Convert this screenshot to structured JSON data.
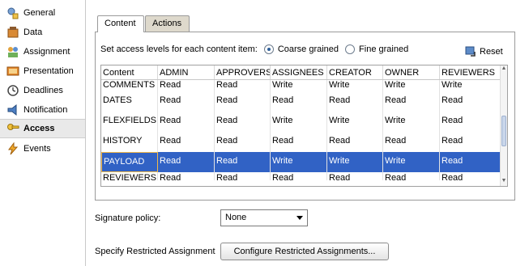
{
  "nav": {
    "items": [
      {
        "label": "General",
        "icon": "general-icon"
      },
      {
        "label": "Data",
        "icon": "data-icon"
      },
      {
        "label": "Assignment",
        "icon": "assignment-icon"
      },
      {
        "label": "Presentation",
        "icon": "presentation-icon"
      },
      {
        "label": "Deadlines",
        "icon": "deadlines-icon"
      },
      {
        "label": "Notification",
        "icon": "notification-icon"
      },
      {
        "label": "Access",
        "icon": "access-icon",
        "selected": true
      },
      {
        "label": "Events",
        "icon": "events-icon"
      }
    ]
  },
  "tabs": [
    {
      "label": "Content",
      "active": true
    },
    {
      "label": "Actions",
      "active": false
    }
  ],
  "access": {
    "prompt": "Set access levels for each content item:",
    "options": [
      "Coarse grained",
      "Fine grained"
    ],
    "selected": "Coarse grained",
    "reset_label": "Reset"
  },
  "table": {
    "columns": [
      "Content",
      "ADMIN",
      "APPROVERS",
      "ASSIGNEES",
      "CREATOR",
      "OWNER",
      "REVIEWERS"
    ],
    "rows": [
      [
        "COMMENTS",
        "Read",
        "Read",
        "Write",
        "Write",
        "Write",
        "Write"
      ],
      [
        "DATES",
        "Read",
        "Read",
        "Read",
        "Read",
        "Read",
        "Read"
      ],
      [
        "FLEXFIELDS",
        "Read",
        "Read",
        "Write",
        "Write",
        "Write",
        "Read"
      ],
      [
        "HISTORY",
        "Read",
        "Read",
        "Read",
        "Read",
        "Read",
        "Read"
      ],
      [
        "PAYLOAD",
        "Read",
        "Read",
        "Write",
        "Write",
        "Write",
        "Read"
      ],
      [
        "REVIEWERS",
        "Read",
        "Read",
        "Read",
        "Read",
        "Read",
        "Read"
      ]
    ],
    "selected_row": "PAYLOAD"
  },
  "signature": {
    "label": "Signature policy:",
    "value": "None"
  },
  "restricted": {
    "label": "Specify Restricted Assignment",
    "button_label": "Configure Restricted Assignments..."
  },
  "colors": {
    "selection": "#3162c5",
    "tab_inactive": "#ded9cc"
  }
}
